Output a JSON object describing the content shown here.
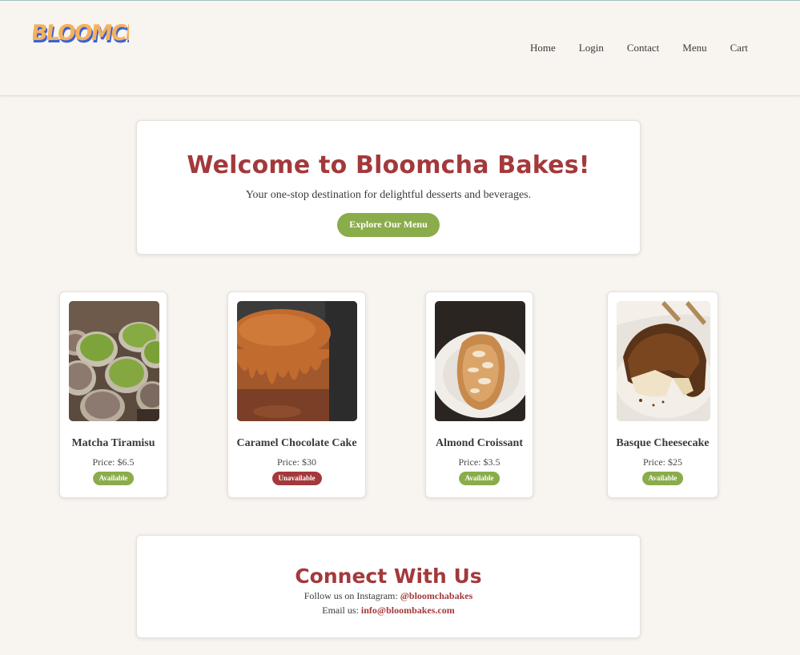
{
  "header": {
    "logo_text": "BLOOMCHA",
    "nav": [
      "Home",
      "Login",
      "Contact",
      "Menu",
      "Cart"
    ]
  },
  "hero": {
    "title": "Welcome to Bloomcha Bakes!",
    "subtitle": "Your one-stop destination for delightful desserts and beverages.",
    "button_label": "Explore Our Menu"
  },
  "products": [
    {
      "name": "Matcha Tiramisu",
      "price": "Price: $6.5",
      "status": "Available"
    },
    {
      "name": "Caramel Chocolate Cake",
      "price": "Price: $30",
      "status": "Unavailable"
    },
    {
      "name": "Almond Croissant",
      "price": "Price: $3.5",
      "status": "Available"
    },
    {
      "name": "Basque Cheesecake",
      "price": "Price: $25",
      "status": "Available"
    }
  ],
  "contact": {
    "title": "Connect With Us",
    "instagram_prefix": "Follow us on Instagram: ",
    "instagram_handle": "@bloomchabakes",
    "email_prefix": "Email us: ",
    "email": "info@bloombakes.com"
  },
  "colors": {
    "page_background": "#f8f4ef",
    "accent_red": "#a3393b",
    "accent_green": "#8aac4b",
    "logo_orange": "#f4b15e",
    "logo_blue": "#3a62d6"
  }
}
